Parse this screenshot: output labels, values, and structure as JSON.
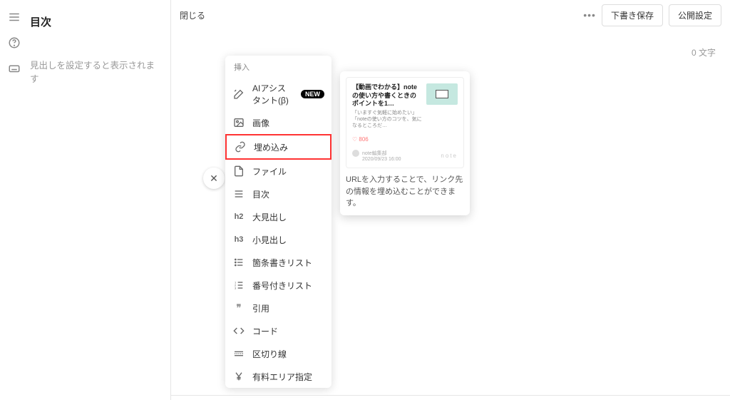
{
  "sidebar": {
    "title": "目次",
    "empty_message": "見出しを設定すると表示されます"
  },
  "topbar": {
    "close_label": "閉じる",
    "draft_save_label": "下書き保存",
    "publish_label": "公開設定"
  },
  "editor": {
    "char_count": "0 文字"
  },
  "insert_menu": {
    "header": "挿入",
    "items": [
      {
        "label": "AIアシスタント(β)",
        "icon": "wand-icon",
        "badge": "NEW"
      },
      {
        "label": "画像",
        "icon": "image-icon"
      },
      {
        "label": "埋め込み",
        "icon": "link-icon",
        "highlight": true
      },
      {
        "label": "ファイル",
        "icon": "file-icon"
      },
      {
        "label": "目次",
        "icon": "list-icon"
      },
      {
        "label": "大見出し",
        "icon": "h2-icon",
        "icon_text": "h2"
      },
      {
        "label": "小見出し",
        "icon": "h3-icon",
        "icon_text": "h3"
      },
      {
        "label": "箇条書きリスト",
        "icon": "bullet-list-icon"
      },
      {
        "label": "番号付きリスト",
        "icon": "ordered-list-icon"
      },
      {
        "label": "引用",
        "icon": "quote-icon"
      },
      {
        "label": "コード",
        "icon": "code-icon"
      },
      {
        "label": "区切り線",
        "icon": "divider-icon"
      },
      {
        "label": "有料エリア指定",
        "icon": "yen-icon"
      }
    ]
  },
  "tooltip": {
    "preview": {
      "title": "【動画でわかる】noteの使い方や書くときのポイントを1…",
      "description": "「いますぐ気軽に始めたい」「noteの使い方のコツを、気になるところだ…",
      "likes": "♡ 806",
      "author": "note編集部",
      "date": "2020/09/23 16:00",
      "brand": "note"
    },
    "text": "URLを入力することで、リンク先の情報を埋め込むことができます。"
  }
}
